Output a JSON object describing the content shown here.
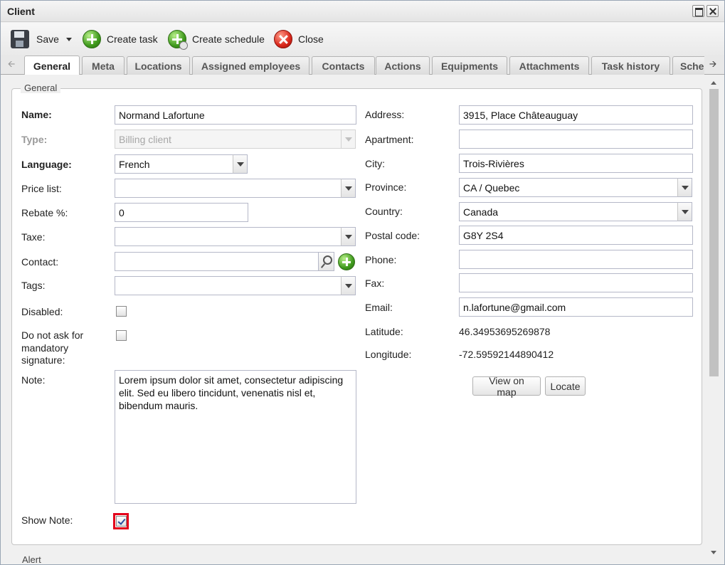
{
  "window": {
    "title": "Client"
  },
  "toolbar": {
    "save_label": "Save",
    "create_task_label": "Create task",
    "create_schedule_label": "Create schedule",
    "close_label": "Close"
  },
  "tabs": [
    "General",
    "Meta",
    "Locations",
    "Assigned employees",
    "Contacts",
    "Actions",
    "Equipments",
    "Attachments",
    "Task history",
    "Sche"
  ],
  "section": {
    "legend": "General",
    "next_legend": "Alert"
  },
  "left": {
    "name": {
      "label": "Name:",
      "value": "Normand Lafortune"
    },
    "type": {
      "label": "Type:",
      "value": "Billing client"
    },
    "language": {
      "label": "Language:",
      "value": "French"
    },
    "price_list": {
      "label": "Price list:",
      "value": ""
    },
    "rebate": {
      "label": "Rebate %:",
      "value": "0"
    },
    "taxe": {
      "label": "Taxe:",
      "value": ""
    },
    "contact": {
      "label": "Contact:",
      "value": ""
    },
    "tags": {
      "label": "Tags:",
      "value": ""
    },
    "disabled": {
      "label": "Disabled:",
      "checked": false
    },
    "mandatory_signature": {
      "label_1": "Do not ask for",
      "label_2": "mandatory",
      "label_3": "signature:",
      "checked": false
    },
    "note": {
      "label": "Note:",
      "value": "Lorem ipsum dolor sit amet, consectetur adipiscing elit. Sed eu libero tincidunt, venenatis nisl et, bibendum mauris."
    },
    "show_note": {
      "label": "Show Note:",
      "checked": true
    }
  },
  "right": {
    "address": {
      "label": "Address:",
      "value": "3915, Place Châteauguay"
    },
    "apartment": {
      "label": "Apartment:",
      "value": ""
    },
    "city": {
      "label": "City:",
      "value": "Trois-Rivières"
    },
    "province": {
      "label": "Province:",
      "value": "CA / Quebec"
    },
    "country": {
      "label": "Country:",
      "value": "Canada"
    },
    "postal_code": {
      "label": "Postal code:",
      "value": "G8Y 2S4"
    },
    "phone": {
      "label": "Phone:",
      "value": ""
    },
    "fax": {
      "label": "Fax:",
      "value": ""
    },
    "email": {
      "label": "Email:",
      "value": "n.lafortune@gmail.com"
    },
    "latitude": {
      "label": "Latitude:",
      "value": "46.34953695269878"
    },
    "longitude": {
      "label": "Longitude:",
      "value": "-72.59592144890412"
    },
    "view_on_map_label": "View on map",
    "locate_label": "Locate"
  },
  "colors": {
    "highlight": "#e3001b",
    "accent_green": "#3f9a1d",
    "close_red": "#d9261a"
  }
}
